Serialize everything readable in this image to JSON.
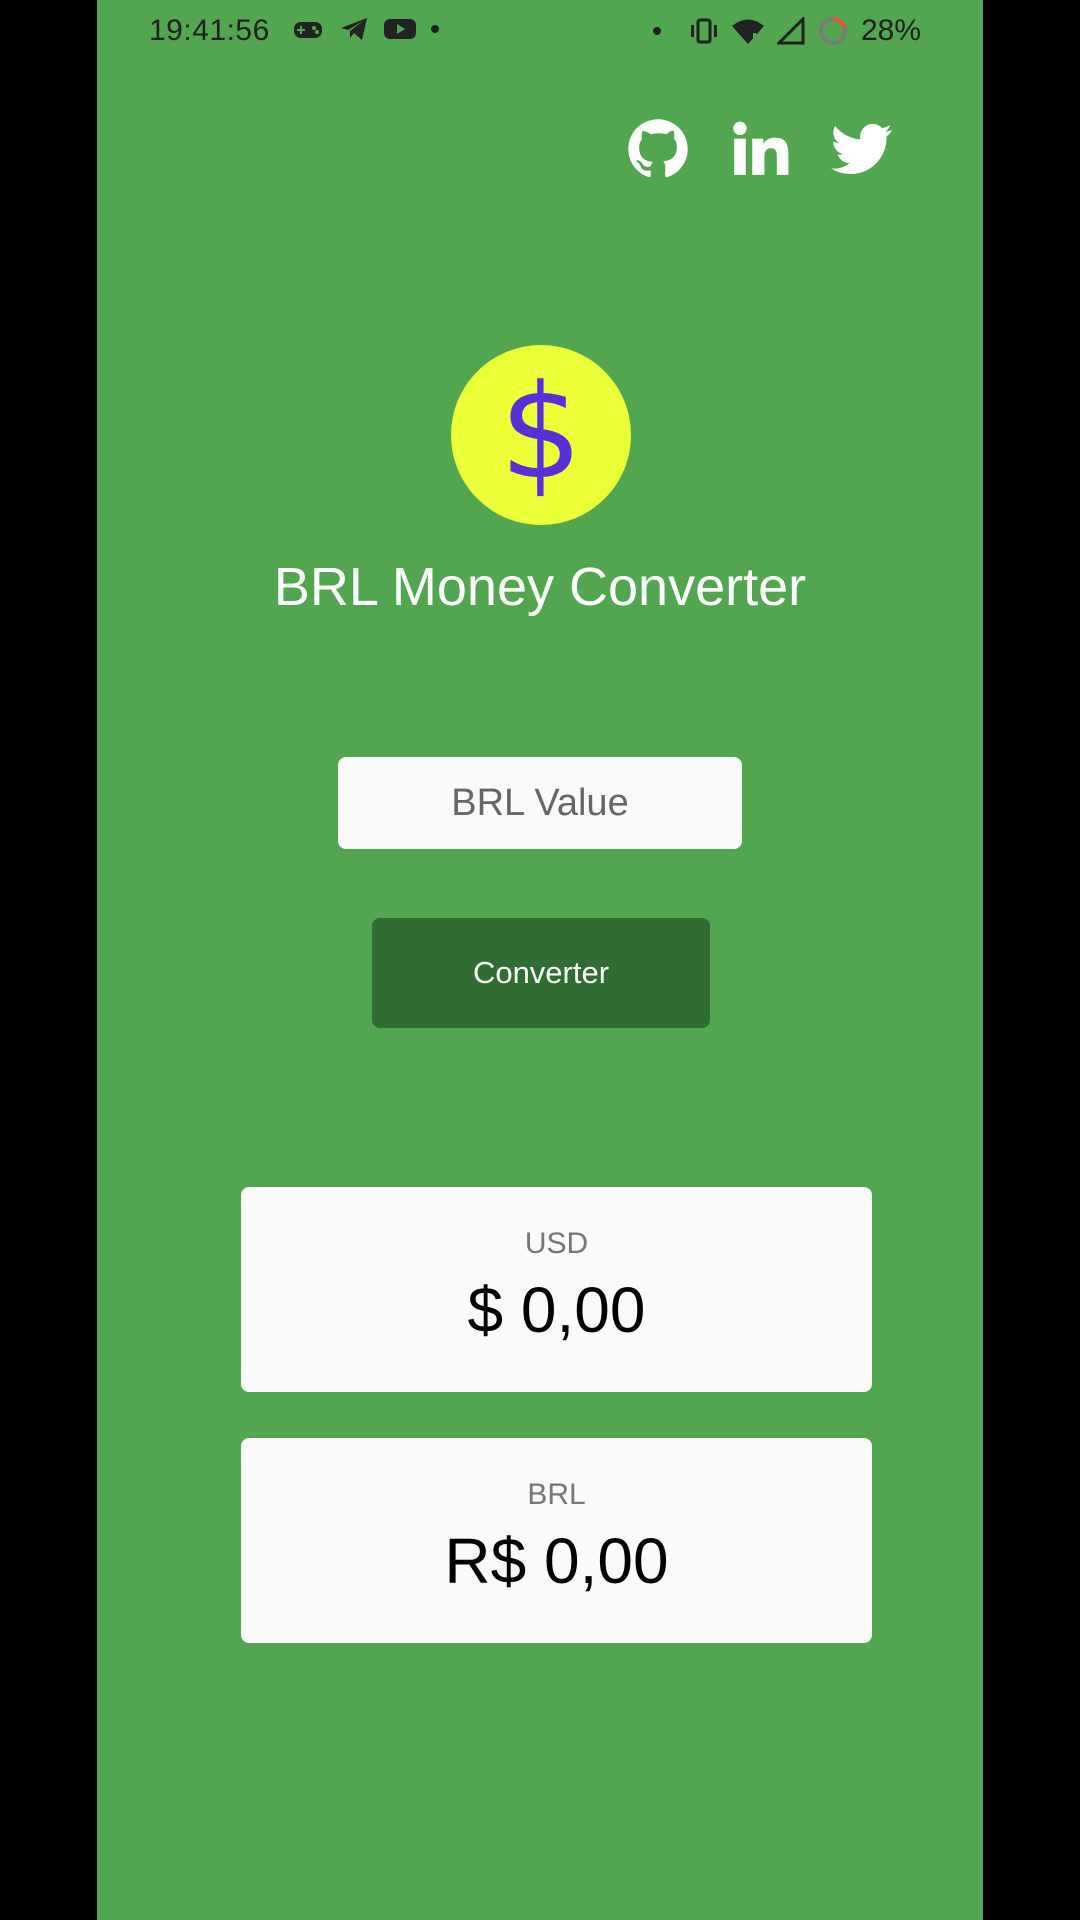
{
  "status_bar": {
    "time": "19:41:56",
    "battery": "28%",
    "left_icons": [
      "game-controller-icon",
      "telegram-icon",
      "youtube-icon",
      "dot"
    ],
    "right_icons": [
      "dot",
      "vibrate-icon",
      "wifi-icon",
      "signal-icon",
      "battery-ring-icon"
    ]
  },
  "social": [
    "github-icon",
    "linkedin-icon",
    "twitter-icon"
  ],
  "logo": {
    "glyph": "$",
    "bg": "#ebff38",
    "fg": "#5a2fd8"
  },
  "title": "BRL Money Converter",
  "input": {
    "placeholder": "BRL Value",
    "value": ""
  },
  "convert_button": "Converter",
  "cards": {
    "usd": {
      "label": "USD",
      "value": "$ 0,00"
    },
    "brl": {
      "label": "BRL",
      "value": "R$ 0,00"
    }
  },
  "colors": {
    "background": "#51a64f",
    "button": "#2f6d33",
    "card": "#fafafa"
  }
}
